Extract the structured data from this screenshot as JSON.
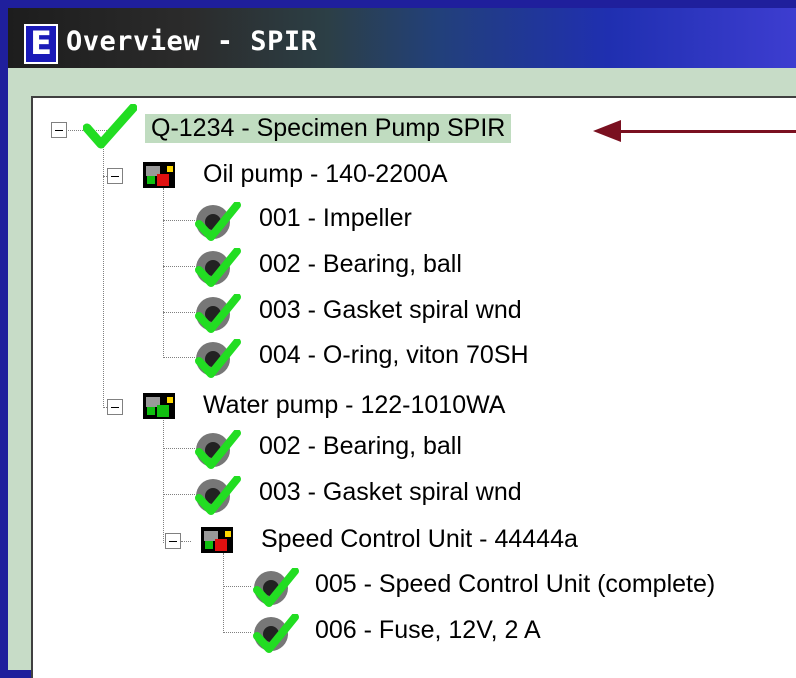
{
  "window": {
    "app_icon_letter": "E",
    "title": "Overview - SPIR"
  },
  "tree": {
    "root": {
      "label": "Q-1234 - Specimen Pump SPIR",
      "status": "ok"
    },
    "groups": [
      {
        "label": "Oil pump - 140-2200A",
        "items": [
          "001 - Impeller",
          "002 - Bearing, ball",
          "003 - Gasket spiral wnd",
          "004 - O-ring, viton 70SH"
        ]
      },
      {
        "label": "Water pump - 122-1010WA",
        "items": [
          "002 - Bearing, ball",
          "003 - Gasket spiral wnd"
        ],
        "subgroup": {
          "label": "Speed Control Unit - 44444a",
          "items": [
            "005 - Speed Control Unit (complete)",
            "006 - Fuse, 12V, 2 A"
          ]
        }
      }
    ]
  },
  "colors": {
    "checkmark": "#22dd22",
    "arrow": "#7a1020",
    "highlight": "#c0dcc0",
    "background": "#1f1f9c"
  }
}
